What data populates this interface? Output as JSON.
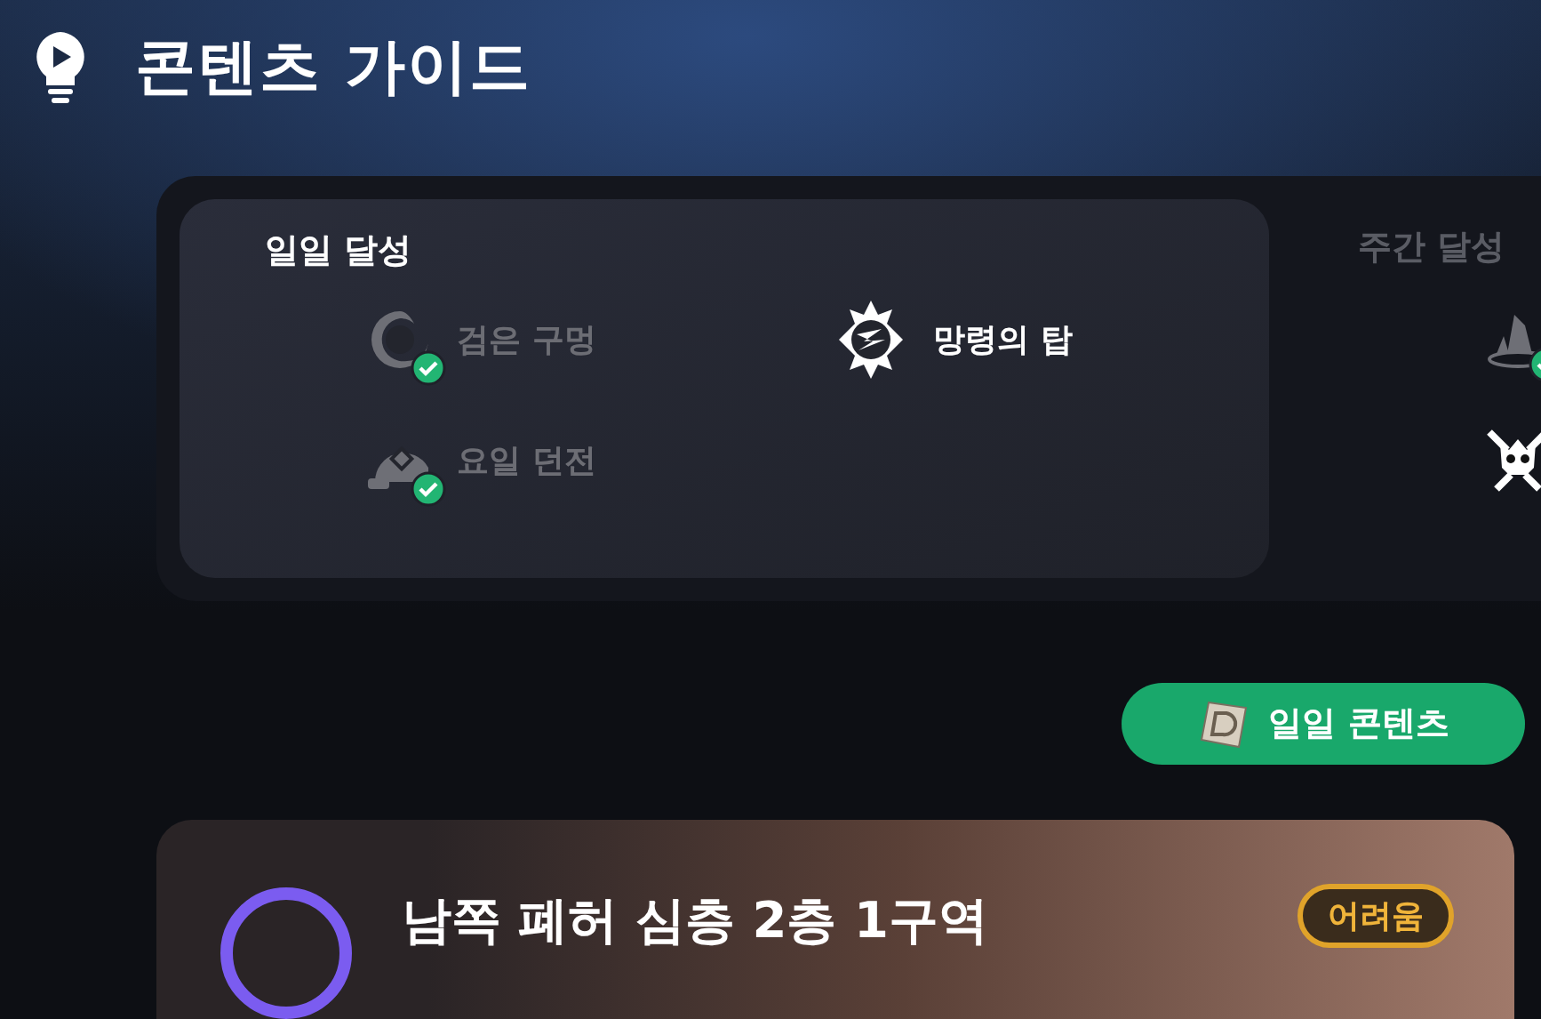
{
  "header": {
    "title": "콘텐츠 가이드"
  },
  "daily": {
    "title": "일일 달성",
    "items": [
      {
        "label": "검은 구멍",
        "kind": "vortex",
        "completed": true
      },
      {
        "label": "망령의 탑",
        "kind": "compass",
        "completed": false
      },
      {
        "label": "요일 던전",
        "kind": "dungeon",
        "completed": true
      }
    ]
  },
  "weekly": {
    "title": "주간 달성",
    "items": [
      {
        "kind": "crystal",
        "completed": true
      },
      {
        "kind": "skull",
        "completed": false
      }
    ]
  },
  "daily_button": {
    "label": "일일 콘텐츠"
  },
  "zone": {
    "title": "남쪽 폐허 심층 2층 1구역",
    "difficulty": "어려움"
  }
}
